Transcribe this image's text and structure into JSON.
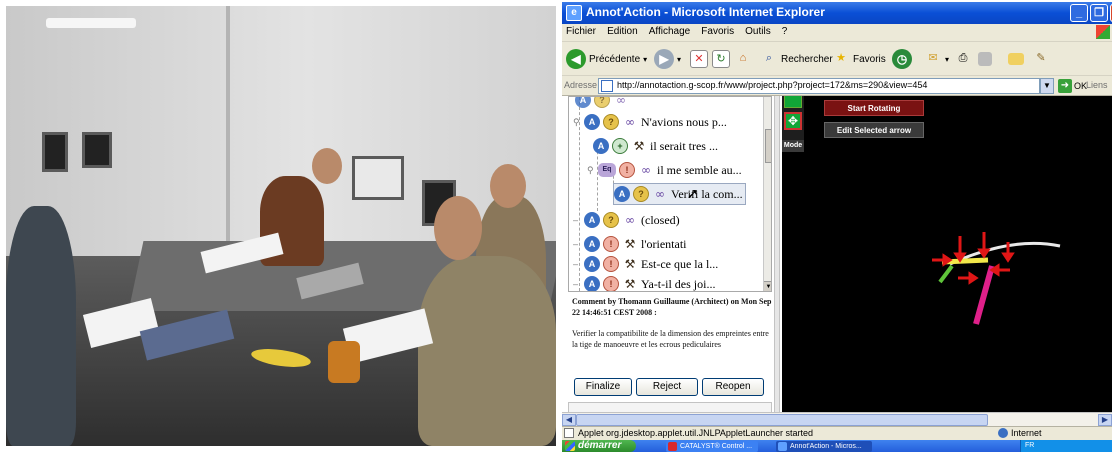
{
  "window": {
    "title": "Annot'Action - Microsoft Internet Explorer",
    "app_icon": "ie-icon",
    "buttons": [
      "minimize",
      "maximize",
      "close"
    ]
  },
  "menubar": {
    "items": [
      "Fichier",
      "Edition",
      "Affichage",
      "Favoris",
      "Outils",
      "?"
    ]
  },
  "toolbar": {
    "back_label": "Précédente",
    "search_label": "Rechercher",
    "favorites_label": "Favoris"
  },
  "addressbar": {
    "label": "Adresse",
    "url": "http://annotaction.g-scop.fr/www/project.php?project=172&ms=290&view=454",
    "go_label": "OK",
    "links_label": "Liens"
  },
  "tree": {
    "items": [
      {
        "label": "N'avions nous p...",
        "icons": [
          "A",
          "bulb",
          "people"
        ],
        "level": 0
      },
      {
        "label": "il serait tres ...",
        "icons": [
          "A",
          "plus",
          "hammer"
        ],
        "level": 1
      },
      {
        "label": "il me semble au...",
        "icons": [
          "eq",
          "exclaim",
          "people"
        ],
        "level": 1
      },
      {
        "label": "Verifi la com...",
        "icons": [
          "A",
          "bulb",
          "people"
        ],
        "level": 2,
        "selected": true
      },
      {
        "label": "(closed)",
        "icons": [
          "A",
          "bulb",
          "people"
        ],
        "level": 0
      },
      {
        "label": "l'orientati",
        "icons": [
          "A",
          "exclaim",
          "hammer"
        ],
        "level": 0
      },
      {
        "label": "Est-ce que la l...",
        "icons": [
          "A",
          "exclaim",
          "hammer"
        ],
        "level": 0
      },
      {
        "label": "Ya-t-il des joi...",
        "icons": [
          "A",
          "exclaim",
          "hammer"
        ],
        "level": 0
      }
    ]
  },
  "comment": {
    "meta": "Comment by Thomann Guillaume (Architect) on Mon Sep 22 14:46:51 CEST 2008 :",
    "text": "Verifier la compatibilite de la dimension des empreintes entre la tige de manoeuvre et les ecrous pediculaires"
  },
  "actions": {
    "finalize": "Finalize",
    "reject": "Reject",
    "reopen": "Reopen"
  },
  "applet": {
    "start_rotating": "Start Rotating",
    "edit_arrow": "Edit Selected arrow",
    "mode": "Mode"
  },
  "statusbar": {
    "message": "Applet org.jdesktop.applet.util.JNLPAppletLauncher started",
    "zone": "Internet"
  },
  "taskbar": {
    "start": "démarrer",
    "tasks": [
      "CATALYST® Control ...",
      "Annot'Action - Micros..."
    ],
    "tray": "FR"
  },
  "colors": {
    "titlebar": "#0a4fd6",
    "taskbar": "#245edb",
    "start_button": "#2c8a2c",
    "applet_background": "#000000",
    "start_rotating_button": "#7a1212"
  }
}
